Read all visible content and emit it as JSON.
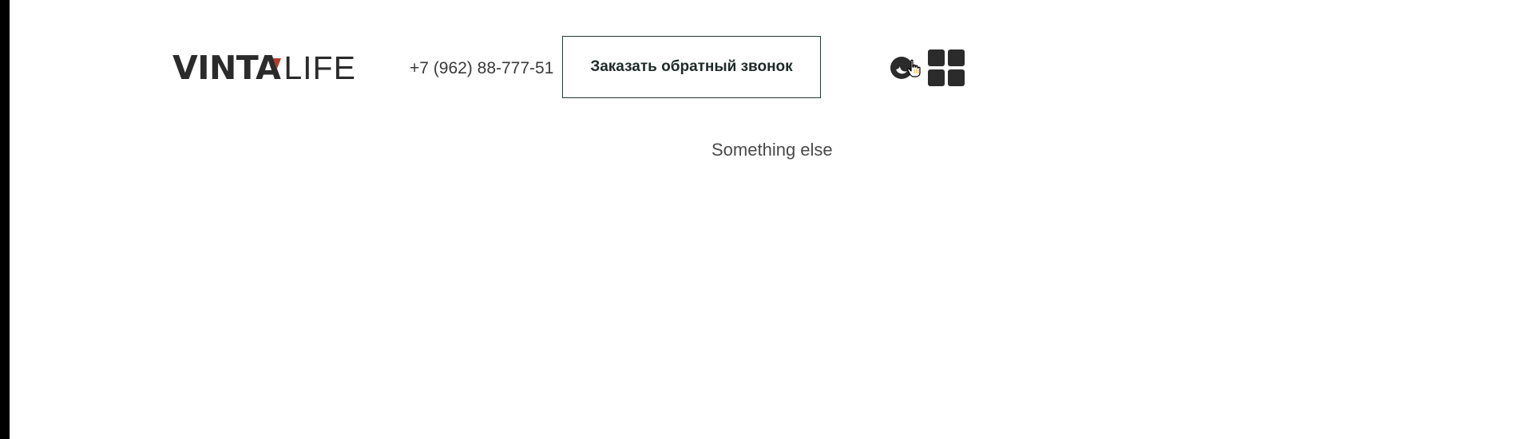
{
  "header": {
    "logo": {
      "bold_text": "VINTA",
      "light_text": "LIFE",
      "accent_color": "#b83a2c"
    },
    "phone": "+7 (962) 88-777-51",
    "callback_button_label": "Заказать обратный звонок",
    "theme_toggle_icon": "moon-icon",
    "menu_icon": "grid-menu-icon"
  },
  "main": {
    "tagline": "Something else"
  }
}
